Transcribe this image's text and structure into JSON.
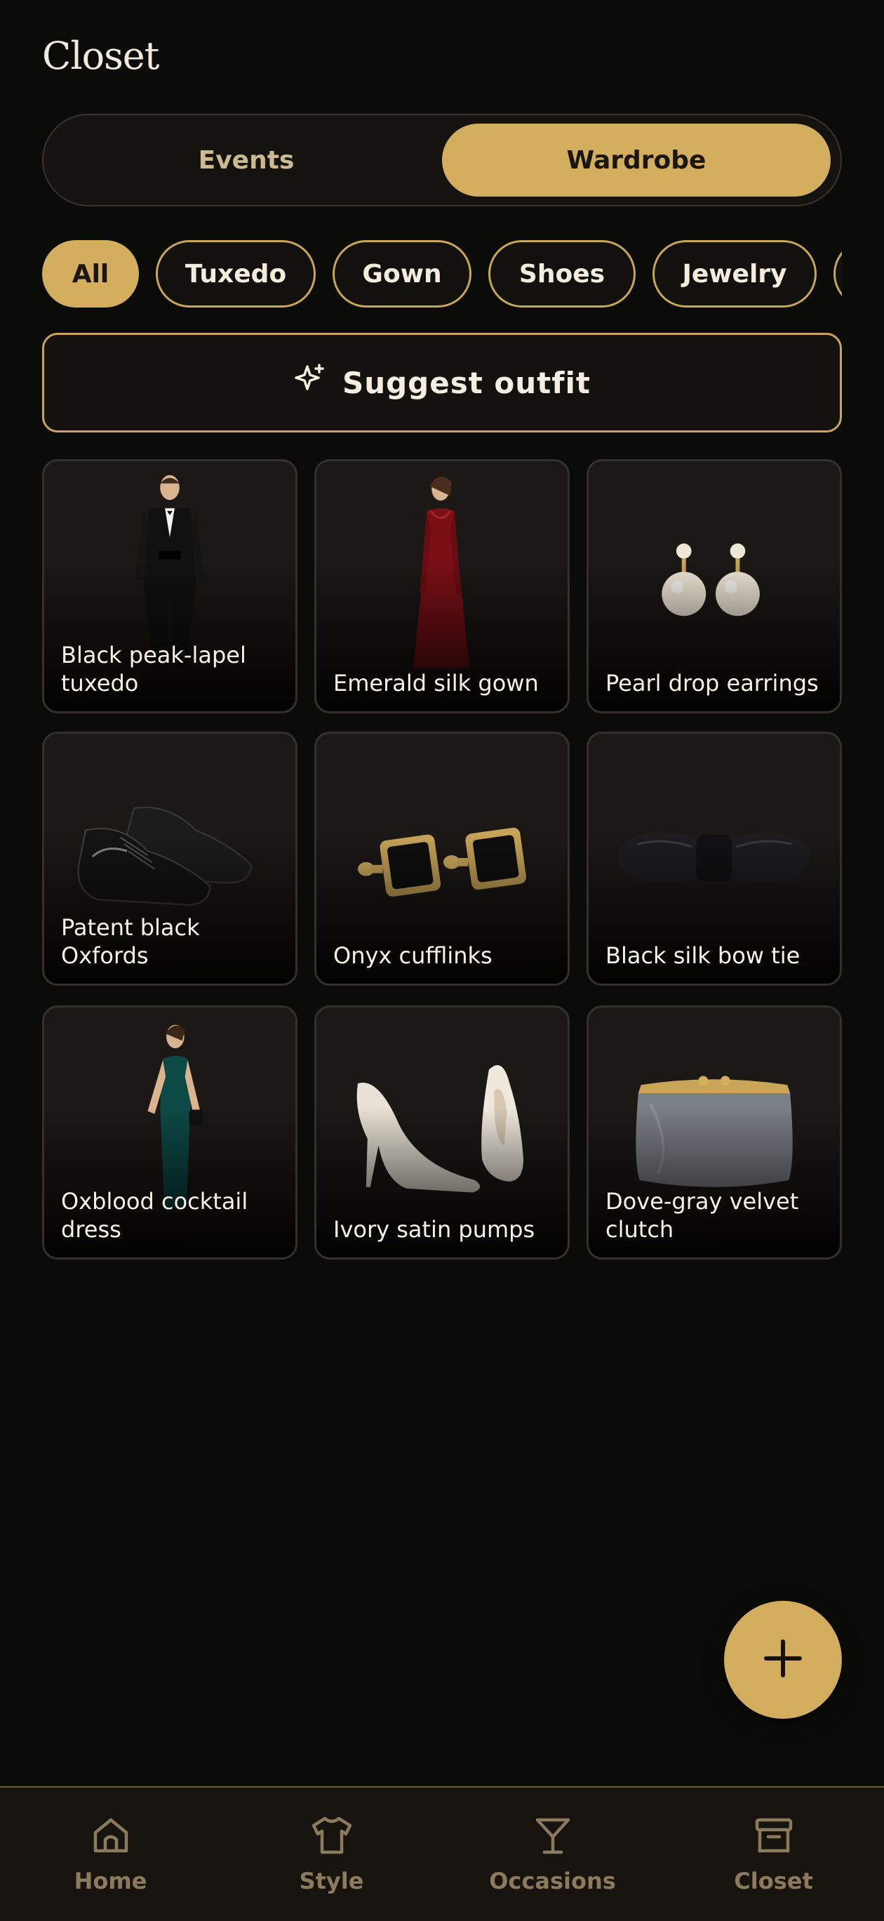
{
  "header": {
    "title": "Closet"
  },
  "segment": {
    "options": [
      "Events",
      "Wardrobe"
    ],
    "selected": "Wardrobe"
  },
  "filters": {
    "chips": [
      "All",
      "Tuxedo",
      "Gown",
      "Shoes",
      "Jewelry"
    ],
    "selected": "All"
  },
  "suggest": {
    "label": "Suggest outfit",
    "icon": "sparkle-icon"
  },
  "items": [
    {
      "label": "Black peak-lapel tuxedo",
      "icon": "tuxedo-figure"
    },
    {
      "label": "Emerald silk gown",
      "icon": "gown-figure"
    },
    {
      "label": "Pearl drop earrings",
      "icon": "pearl-earrings"
    },
    {
      "label": "Patent black Oxfords",
      "icon": "oxford-shoes"
    },
    {
      "label": "Onyx cufflinks",
      "icon": "cufflinks"
    },
    {
      "label": "Black silk bow tie",
      "icon": "bow-tie"
    },
    {
      "label": "Oxblood cocktail dress",
      "icon": "cocktail-dress-figure"
    },
    {
      "label": "Ivory satin pumps",
      "icon": "pumps"
    },
    {
      "label": "Dove-gray velvet clutch",
      "icon": "clutch"
    }
  ],
  "fab": {
    "icon": "plus-icon"
  },
  "bottom_nav": [
    {
      "label": "Home",
      "icon": "home-icon"
    },
    {
      "label": "Style",
      "icon": "shirt-icon"
    },
    {
      "label": "Occasions",
      "icon": "cocktail-glass-icon"
    },
    {
      "label": "Closet",
      "icon": "archive-box-icon"
    }
  ],
  "colors": {
    "accent": "#d2ae5e",
    "background": "#0b0b0a",
    "card": "#1b1815",
    "nav_inactive": "#8c7a5c"
  }
}
